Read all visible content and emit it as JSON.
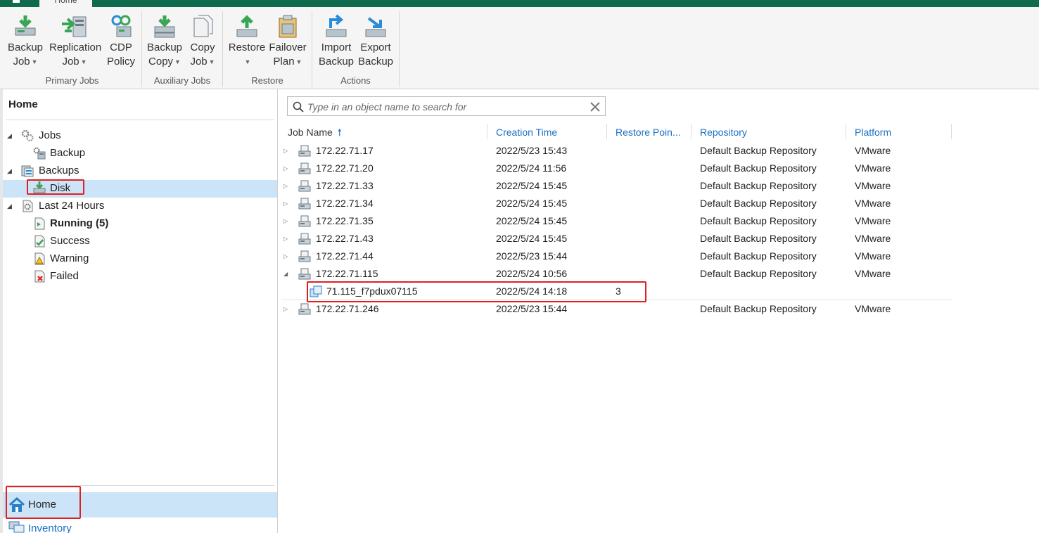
{
  "tabs": {
    "home": "Home"
  },
  "ribbon": {
    "groups": [
      {
        "label": "Primary Jobs",
        "buttons": [
          {
            "line1": "Backup",
            "line2": "Job"
          },
          {
            "line1": "Replication",
            "line2": "Job"
          },
          {
            "line1": "CDP",
            "line2": "Policy"
          }
        ]
      },
      {
        "label": "Auxiliary Jobs",
        "buttons": [
          {
            "line1": "Backup",
            "line2": "Copy"
          },
          {
            "line1": "Copy",
            "line2": "Job"
          }
        ]
      },
      {
        "label": "Restore",
        "buttons": [
          {
            "line1": "Restore",
            "line2": ""
          },
          {
            "line1": "Failover",
            "line2": "Plan"
          }
        ]
      },
      {
        "label": "Actions",
        "buttons": [
          {
            "line1": "Import",
            "line2": "Backup"
          },
          {
            "line1": "Export",
            "line2": "Backup"
          }
        ]
      }
    ]
  },
  "sidebar": {
    "title": "Home",
    "tree": [
      {
        "label": "Jobs"
      },
      {
        "label": "Backup"
      },
      {
        "label": "Backups"
      },
      {
        "label": "Disk"
      },
      {
        "label": "Last 24 Hours"
      },
      {
        "label": "Running (5)"
      },
      {
        "label": "Success"
      },
      {
        "label": "Warning"
      },
      {
        "label": "Failed"
      }
    ],
    "nav": {
      "home": "Home",
      "inventory": "Inventory"
    }
  },
  "search": {
    "placeholder": "Type in an object name to search for"
  },
  "table": {
    "columns": [
      "Job Name",
      "Creation Time",
      "Restore Poin...",
      "Repository",
      "Platform"
    ],
    "rows": [
      {
        "name": "172.22.71.17",
        "time": "2022/5/23 15:43",
        "points": "",
        "repo": "Default Backup Repository",
        "platform": "VMware"
      },
      {
        "name": "172.22.71.20",
        "time": "2022/5/24 11:56",
        "points": "",
        "repo": "Default Backup Repository",
        "platform": "VMware"
      },
      {
        "name": "172.22.71.33",
        "time": "2022/5/24 15:45",
        "points": "",
        "repo": "Default Backup Repository",
        "platform": "VMware"
      },
      {
        "name": "172.22.71.34",
        "time": "2022/5/24 15:45",
        "points": "",
        "repo": "Default Backup Repository",
        "platform": "VMware"
      },
      {
        "name": "172.22.71.35",
        "time": "2022/5/24 15:45",
        "points": "",
        "repo": "Default Backup Repository",
        "platform": "VMware"
      },
      {
        "name": "172.22.71.43",
        "time": "2022/5/24 15:45",
        "points": "",
        "repo": "Default Backup Repository",
        "platform": "VMware"
      },
      {
        "name": "172.22.71.44",
        "time": "2022/5/23 15:44",
        "points": "",
        "repo": "Default Backup Repository",
        "platform": "VMware"
      },
      {
        "name": "172.22.71.115",
        "time": "2022/5/24 10:56",
        "points": "",
        "repo": "Default Backup Repository",
        "platform": "VMware"
      },
      {
        "name": "71.115_f7pdux07115",
        "time": "2022/5/24 14:18",
        "points": "3",
        "repo": "",
        "platform": ""
      },
      {
        "name": "172.22.71.246",
        "time": "2022/5/23 15:44",
        "points": "",
        "repo": "Default Backup Repository",
        "platform": "VMware"
      }
    ]
  },
  "colors": {
    "accent": "#0e6b4d",
    "selection": "#cce4f7",
    "link": "#1a6fc2",
    "highlight": "#e02020"
  }
}
